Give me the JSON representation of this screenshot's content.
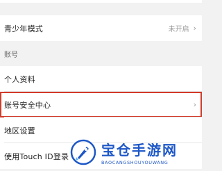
{
  "settings": {
    "teen_mode": {
      "label": "青少年模式",
      "value": "未开启",
      "chevron": "›"
    },
    "account_section": {
      "title": "账号"
    },
    "profile": {
      "label": "个人资料"
    },
    "security_center": {
      "label": "账号安全中心",
      "chevron": "›"
    },
    "region": {
      "label": "地区设置"
    },
    "touch_id": {
      "label": "使用Touch ID登录"
    }
  },
  "watermark": {
    "title": "宝仓手游网",
    "subtitle": "BAOCANGSHOUYOUWANG",
    "color": "#1d57c7"
  },
  "highlight_color": "#d23b2a"
}
